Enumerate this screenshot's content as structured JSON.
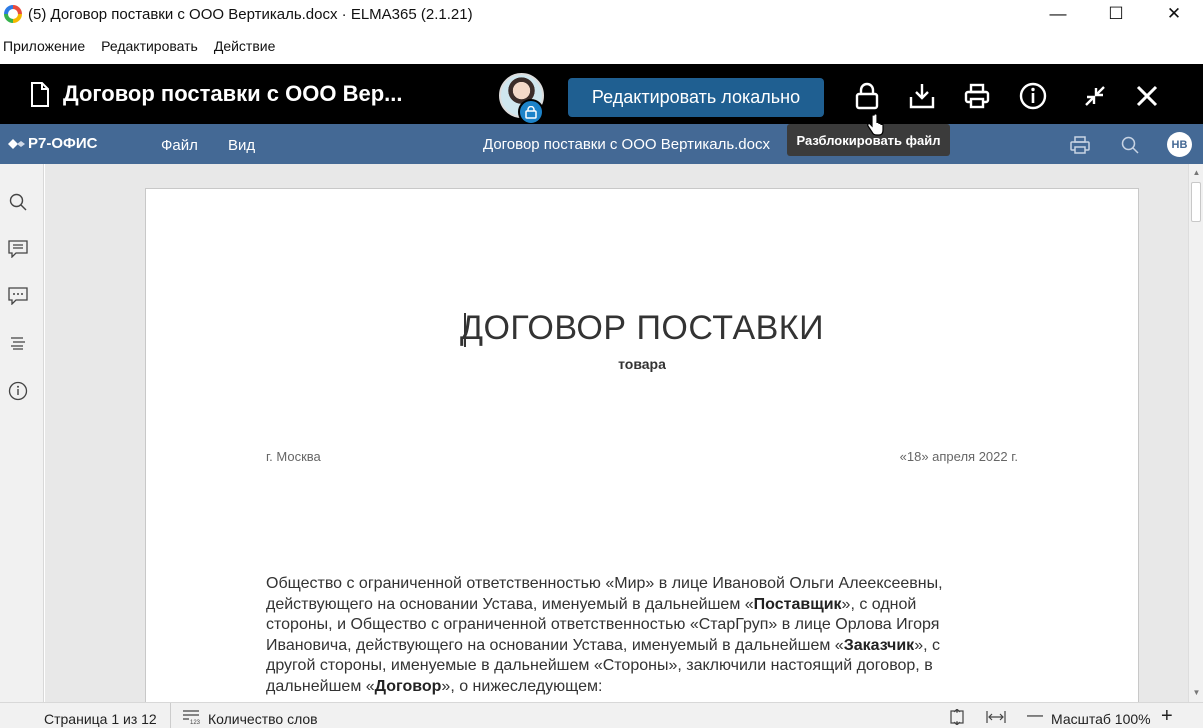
{
  "window": {
    "title": "(5) Договор поставки с ООО Вертикаль.docx · ELMA365 (2.1.21)",
    "minimize": "—",
    "maximize": "☐",
    "close": "✕"
  },
  "menubar": [
    "Приложение",
    "Редактировать",
    "Действие"
  ],
  "header": {
    "doc_title": "Договор поставки с ООО Вер...",
    "edit_button": "Редактировать локально",
    "icons": [
      "lock-icon",
      "download-icon",
      "print-icon",
      "info-icon",
      "collapse-icon",
      "close-icon"
    ]
  },
  "tooltip": "Разблокировать файл",
  "r7": {
    "logo": "Р7-ОФИС",
    "menu": [
      "Файл",
      "Вид"
    ],
    "doc_name": "Договор поставки с ООО Вертикаль.docx",
    "user_initials": "НВ"
  },
  "leftbar": [
    "search-icon",
    "comments-icon",
    "chat-icon",
    "navigation-icon",
    "about-icon"
  ],
  "document": {
    "title": "ДОГОВОР ПОСТАВКИ",
    "subtitle": "товара",
    "city": "г. Москва",
    "date": "«18» апреля 2022 г.",
    "para_1": "Общество с ограниченной ответственностью «Мир» в лице Ивановой Ольги Алеексеевны, действующего на основании Устава, именуемый в дальнейшем «",
    "supplier": "Поставщик",
    "para_2": "», с одной стороны, и Общество с ограниченной ответственностью «СтарГруп» в лице Орлова Игоря Ивановича, действующего на основании Устава, именуемый в дальнейшем «",
    "customer": "Заказчик",
    "para_3": "», с другой стороны, именуемые в дальнейшем «Стороны», заключили настоящий договор, в дальнейшем «",
    "contract": "Договор",
    "para_4": "», о нижеследующем:"
  },
  "status": {
    "page": "Страница 1 из 12",
    "word_count": "Количество слов",
    "zoom": "Масштаб 100%"
  },
  "colors": {
    "r7_toolbar": "#446995",
    "edit_button": "#1f5f91",
    "header_bg": "#000000"
  }
}
